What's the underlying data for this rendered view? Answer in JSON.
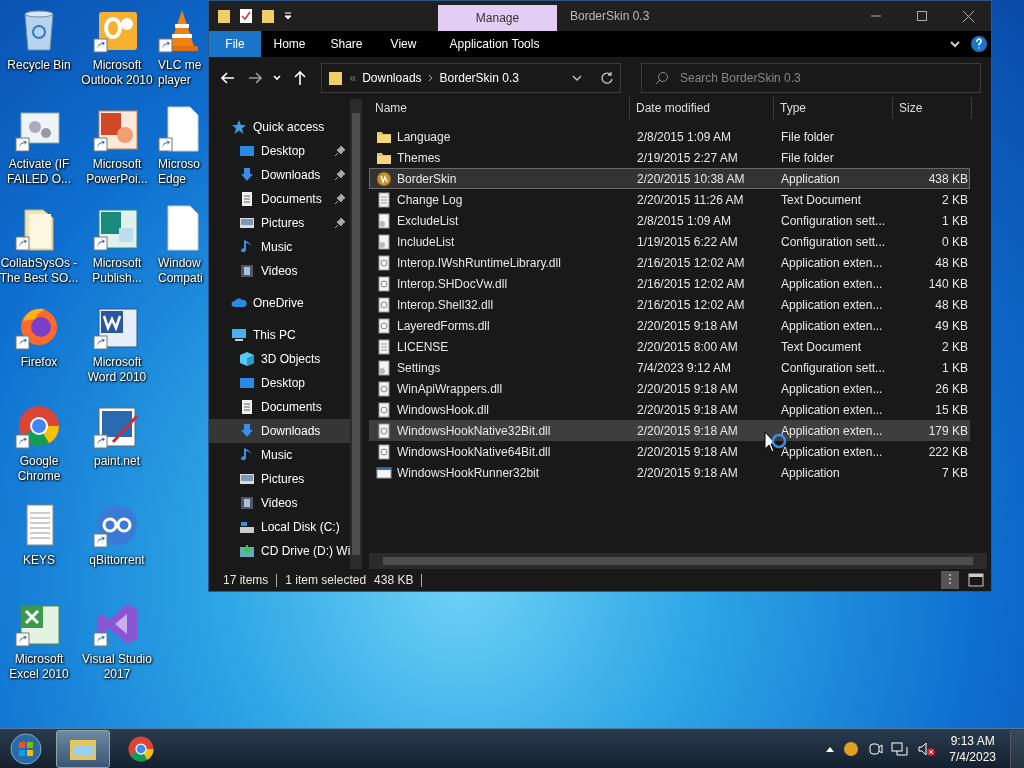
{
  "desktop_icons": [
    {
      "label": [
        "Recycle Bin"
      ],
      "kind": "recycle",
      "shortcut": false,
      "clipped": false
    },
    {
      "label": [
        "Activate (IF",
        "FAILED O..."
      ],
      "kind": "settings",
      "shortcut": true,
      "clipped": false
    },
    {
      "label": [
        "CollabSysOs -",
        "The Best SO..."
      ],
      "kind": "folder",
      "shortcut": true,
      "clipped": false
    },
    {
      "label": [
        "Firefox"
      ],
      "kind": "firefox",
      "shortcut": true,
      "clipped": false
    },
    {
      "label": [
        "Google",
        "Chrome"
      ],
      "kind": "chrome",
      "shortcut": true,
      "clipped": false
    },
    {
      "label": [
        "KEYS"
      ],
      "kind": "text",
      "shortcut": false,
      "clipped": false
    },
    {
      "label": [
        "Microsoft",
        "Excel 2010"
      ],
      "kind": "excel",
      "shortcut": true,
      "clipped": false
    },
    {
      "label": [
        "Microsoft",
        "Outlook 2010"
      ],
      "kind": "outlook",
      "shortcut": true,
      "clipped": false
    },
    {
      "label": [
        "Microsoft",
        "PowerPoi..."
      ],
      "kind": "powerpoint",
      "shortcut": true,
      "clipped": false
    },
    {
      "label": [
        "Microsoft",
        "Publish..."
      ],
      "kind": "publisher",
      "shortcut": true,
      "clipped": false
    },
    {
      "label": [
        "Microsoft",
        "Word 2010"
      ],
      "kind": "word",
      "shortcut": true,
      "clipped": false
    },
    {
      "label": [
        "paint.net"
      ],
      "kind": "paint",
      "shortcut": true,
      "clipped": false
    },
    {
      "label": [
        "qBittorrent"
      ],
      "kind": "qbit",
      "shortcut": true,
      "clipped": false
    },
    {
      "label": [
        "Visual Studio",
        "2017"
      ],
      "kind": "vs",
      "shortcut": true,
      "clipped": false
    },
    {
      "label": [
        "VLC me",
        "player"
      ],
      "kind": "vlc",
      "shortcut": true,
      "clipped": true
    },
    {
      "label": [
        "Microso",
        "Edge"
      ],
      "kind": "blank",
      "shortcut": true,
      "clipped": true
    },
    {
      "label": [
        "Window",
        "Compati"
      ],
      "kind": "blank",
      "shortcut": false,
      "clipped": true
    }
  ],
  "window": {
    "title": "BorderSkin 0.3",
    "context_tab": "Manage",
    "ribbon_tabs": [
      {
        "label": "File",
        "kind": "file"
      },
      {
        "label": "Home",
        "kind": "tab"
      },
      {
        "label": "Share",
        "kind": "tab"
      },
      {
        "label": "View",
        "kind": "tab"
      },
      {
        "label": "Application Tools",
        "kind": "context"
      }
    ],
    "address": {
      "overflow": "«",
      "path": [
        "Downloads",
        "BorderSkin 0.3"
      ]
    },
    "search": {
      "placeholder": "Search BorderSkin 0.3"
    },
    "nav": [
      {
        "label": "Quick access",
        "kind": "star",
        "selected": false,
        "children": [
          {
            "label": "Desktop",
            "kind": "desktop",
            "pinned": true,
            "selected": false
          },
          {
            "label": "Downloads",
            "kind": "downloads",
            "pinned": true,
            "selected": false
          },
          {
            "label": "Documents",
            "kind": "documents",
            "pinned": true,
            "selected": false
          },
          {
            "label": "Pictures",
            "kind": "pictures",
            "pinned": true,
            "selected": false
          },
          {
            "label": "Music",
            "kind": "music",
            "pinned": false,
            "selected": false
          },
          {
            "label": "Videos",
            "kind": "videos",
            "pinned": false,
            "selected": false
          }
        ]
      },
      {
        "label": "OneDrive",
        "kind": "cloud",
        "selected": false
      },
      {
        "label": "This PC",
        "kind": "pc",
        "selected": false,
        "children": [
          {
            "label": "3D Objects",
            "kind": "cube",
            "pinned": false,
            "selected": false
          },
          {
            "label": "Desktop",
            "kind": "desktop",
            "pinned": false,
            "selected": false
          },
          {
            "label": "Documents",
            "kind": "documents",
            "pinned": false,
            "selected": false
          },
          {
            "label": "Downloads",
            "kind": "downloads",
            "pinned": false,
            "selected": true
          },
          {
            "label": "Music",
            "kind": "music",
            "pinned": false,
            "selected": false
          },
          {
            "label": "Pictures",
            "kind": "pictures",
            "pinned": false,
            "selected": false
          },
          {
            "label": "Videos",
            "kind": "videos",
            "pinned": false,
            "selected": false
          },
          {
            "label": "Local Disk (C:)",
            "kind": "disk",
            "pinned": false,
            "selected": false
          },
          {
            "label": "CD Drive (D:) Wi",
            "kind": "cd",
            "pinned": false,
            "selected": false
          }
        ]
      }
    ],
    "columns": [
      "Name",
      "Date modified",
      "Type",
      "Size"
    ],
    "files": [
      {
        "name": "Language",
        "date": "2/8/2015 1:09 AM",
        "type": "File folder",
        "kind": "folder",
        "selected": false,
        "hovered": false
      },
      {
        "name": "Themes",
        "date": "2/19/2015 2:27 AM",
        "type": "File folder",
        "kind": "folder",
        "selected": false,
        "hovered": false
      },
      {
        "name": "BorderSkin",
        "date": "2/20/2015 10:38 AM",
        "type": "Application",
        "size": "438 KB",
        "kind": "app",
        "selected": true,
        "hovered": false
      },
      {
        "name": "Change Log",
        "date": "2/20/2015 11:26 AM",
        "type": "Text Document",
        "size": "2 KB",
        "kind": "text",
        "selected": false,
        "hovered": false
      },
      {
        "name": "ExcludeList",
        "date": "2/8/2015 1:09 AM",
        "type": "Configuration sett...",
        "size": "1 KB",
        "kind": "config",
        "selected": false,
        "hovered": false
      },
      {
        "name": "IncludeList",
        "date": "1/19/2015 6:22 AM",
        "type": "Configuration sett...",
        "size": "0 KB",
        "kind": "config",
        "selected": false,
        "hovered": false
      },
      {
        "name": "Interop.IWshRuntimeLibrary.dll",
        "date": "2/16/2015 12:02 AM",
        "type": "Application exten...",
        "size": "48 KB",
        "kind": "dll",
        "selected": false,
        "hovered": false
      },
      {
        "name": "Interop.SHDocVw.dll",
        "date": "2/16/2015 12:02 AM",
        "type": "Application exten...",
        "size": "140 KB",
        "kind": "dll",
        "selected": false,
        "hovered": false
      },
      {
        "name": "Interop.Shell32.dll",
        "date": "2/16/2015 12:02 AM",
        "type": "Application exten...",
        "size": "48 KB",
        "kind": "dll",
        "selected": false,
        "hovered": false
      },
      {
        "name": "LayeredForms.dll",
        "date": "2/20/2015 9:18 AM",
        "type": "Application exten...",
        "size": "49 KB",
        "kind": "dll",
        "selected": false,
        "hovered": false
      },
      {
        "name": "LICENSE",
        "date": "2/20/2015 8:00 AM",
        "type": "Text Document",
        "size": "2 KB",
        "kind": "text",
        "selected": false,
        "hovered": false
      },
      {
        "name": "Settings",
        "date": "7/4/2023 9:12 AM",
        "type": "Configuration sett...",
        "size": "1 KB",
        "kind": "config",
        "selected": false,
        "hovered": false
      },
      {
        "name": "WinApiWrappers.dll",
        "date": "2/20/2015 9:18 AM",
        "type": "Application exten...",
        "size": "26 KB",
        "kind": "dll",
        "selected": false,
        "hovered": false
      },
      {
        "name": "WindowsHook.dll",
        "date": "2/20/2015 9:18 AM",
        "type": "Application exten...",
        "size": "15 KB",
        "kind": "dll",
        "selected": false,
        "hovered": false
      },
      {
        "name": "WindowsHookNative32Bit.dll",
        "date": "2/20/2015 9:18 AM",
        "type": "Application exten...",
        "size": "179 KB",
        "kind": "dll",
        "selected": false,
        "hovered": true
      },
      {
        "name": "WindowsHookNative64Bit.dll",
        "date": "2/20/2015 9:18 AM",
        "type": "Application exten...",
        "size": "222 KB",
        "kind": "dll",
        "selected": false,
        "hovered": false
      },
      {
        "name": "WindowsHookRunner32bit",
        "date": "2/20/2015 9:18 AM",
        "type": "Application",
        "size": "7 KB",
        "kind": "window",
        "selected": false,
        "hovered": false
      }
    ],
    "status_bar": {
      "count": "17 items",
      "selection": "1 item selected",
      "selection_size": "438 KB"
    }
  },
  "taskbar": {
    "apps": [
      {
        "kind": "explorer",
        "active": true
      },
      {
        "kind": "chrome",
        "active": false
      }
    ],
    "clock": {
      "time": "9:13 AM",
      "date": "7/4/2023"
    }
  }
}
